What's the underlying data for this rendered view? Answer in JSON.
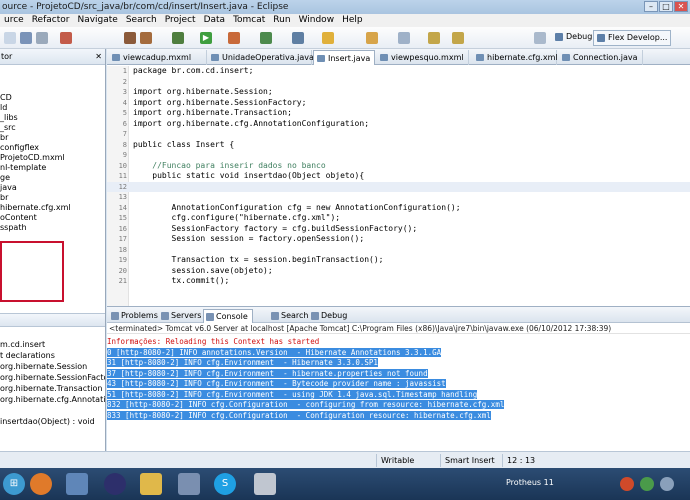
{
  "window": {
    "title": "ource - ProjetoCD/src_java/br/com/cd/insert/Insert.java - Eclipse"
  },
  "menu": [
    "urce",
    "Refactor",
    "Navigate",
    "Search",
    "Project",
    "Data",
    "Tomcat",
    "Run",
    "Window",
    "Help"
  ],
  "perspectives": {
    "debug": "Debug",
    "flex": "Flex Develop..."
  },
  "navigator": {
    "title": "tor",
    "items": [
      "CD",
      "ld",
      "_libs",
      "_src",
      "br",
      "configflex",
      "ProjetoCD.mxml",
      "nl-template",
      "ge",
      "java",
      "br",
      "hibernate.cfg.xml",
      "oContent",
      "sspath"
    ]
  },
  "outline": {
    "items": [
      "m.cd.insert",
      "t declarations",
      "org.hibernate.Session",
      "org.hibernate.SessionFactory",
      "org.hibernate.Transaction",
      "org.hibernate.cfg.AnnotationConfi",
      "",
      "insertdao(Object) : void"
    ]
  },
  "editor_tabs": [
    {
      "label": "viewcadup.mxml",
      "active": false
    },
    {
      "label": "UnidadeOperativa.java",
      "active": false
    },
    {
      "label": "Insert.java",
      "active": true
    },
    {
      "label": "viewpesquo.mxml",
      "active": false
    },
    {
      "label": "hibernate.cfg.xml",
      "active": false
    },
    {
      "label": "Connection.java",
      "active": false
    }
  ],
  "code": [
    {
      "n": "1",
      "t": "package br.com.cd.insert;"
    },
    {
      "n": "2",
      "t": ""
    },
    {
      "n": "3",
      "t": "import org.hibernate.Session;"
    },
    {
      "n": "4",
      "t": "import org.hibernate.SessionFactory;"
    },
    {
      "n": "5",
      "t": "import org.hibernate.Transaction;"
    },
    {
      "n": "6",
      "t": "import org.hibernate.cfg.AnnotationConfiguration;"
    },
    {
      "n": "7",
      "t": ""
    },
    {
      "n": "8",
      "t": "public class Insert {"
    },
    {
      "n": "9",
      "t": ""
    },
    {
      "n": "10",
      "t": "    //Funcao para inserir dados no banco"
    },
    {
      "n": "11",
      "t": "    public static void insertdao(Object objeto){"
    },
    {
      "n": "12",
      "t": ""
    },
    {
      "n": "13",
      "t": ""
    },
    {
      "n": "14",
      "t": "        AnnotationConfiguration cfg = new AnnotationConfiguration();"
    },
    {
      "n": "15",
      "t": "        cfg.configure(\"hibernate.cfg.xml\");"
    },
    {
      "n": "16",
      "t": "        SessionFactory factory = cfg.buildSessionFactory();"
    },
    {
      "n": "17",
      "t": "        Session session = factory.openSession();"
    },
    {
      "n": "18",
      "t": ""
    },
    {
      "n": "19",
      "t": "        Transaction tx = session.beginTransaction();"
    },
    {
      "n": "20",
      "t": "        session.save(objeto);"
    },
    {
      "n": "21",
      "t": "        tx.commit();"
    }
  ],
  "console_tabs": [
    "Problems",
    "Servers",
    "Console",
    "Search",
    "Debug"
  ],
  "console": {
    "info": "<terminated> Tomcat v6.0 Server at localhost [Apache Tomcat] C:\\Program Files (x86)\\Java\\jre7\\bin\\javaw.exe (06/10/2012 17:38:39)",
    "lines": [
      {
        "text": "Informações: Reloading this Context has started",
        "kind": "red"
      },
      {
        "text": "0 [http-8080-2] INFO annotations.Version  - Hibernate Annotations 3.3.1.GA",
        "kind": "sel"
      },
      {
        "text": "31 [http-8080-2] INFO cfg.Environment  - Hibernate 3.3.0.SP1",
        "kind": "sel"
      },
      {
        "text": "37 [http-8080-2] INFO cfg.Environment  - hibernate.properties not found",
        "kind": "sel"
      },
      {
        "text": "43 [http-8080-2] INFO cfg.Environment  - Bytecode provider name : javassist",
        "kind": "sel"
      },
      {
        "text": "51 [http-8080-2] INFO cfg.Environment  - using JDK 1.4 java.sql.Timestamp handling",
        "kind": "sel"
      },
      {
        "text": "832 [http-8080-2] INFO cfg.Configuration  - configuring from resource: hibernate.cfg.xml",
        "kind": "sel"
      },
      {
        "text": "833 [http-8080-2] INFO cfg.Configuration  - Configuration resource: hibernate.cfg.xml",
        "kind": "sel"
      }
    ]
  },
  "status": {
    "mode": "Writable",
    "insert": "Smart Insert",
    "position": "12 : 13"
  },
  "taskbar": {
    "label": "Protheus 11"
  }
}
